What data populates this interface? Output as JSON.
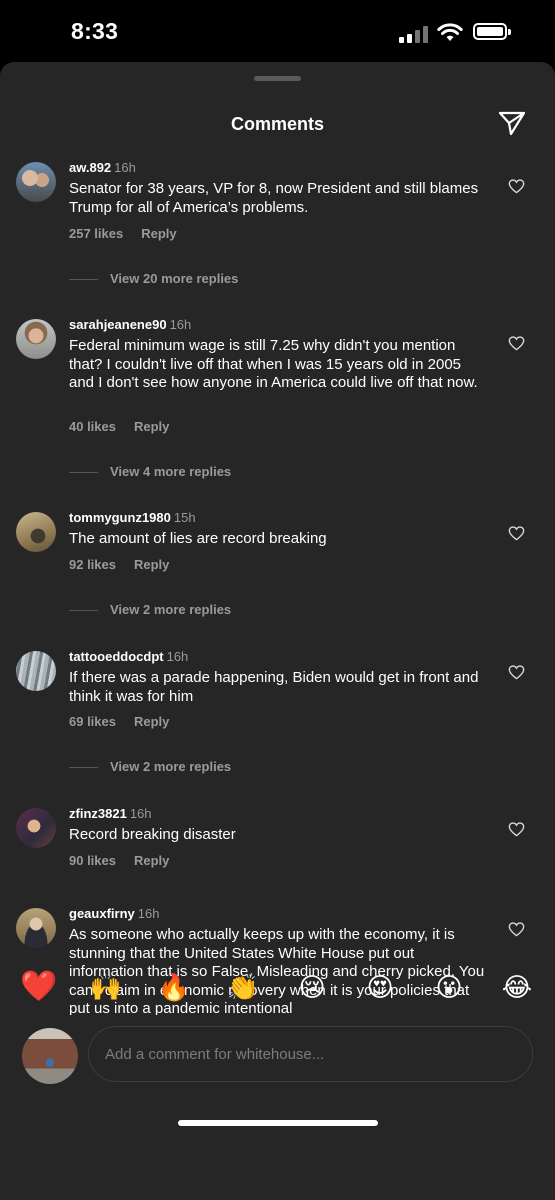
{
  "status": {
    "time": "8:33"
  },
  "header": {
    "title": "Comments"
  },
  "comments": [
    {
      "user": "aw.892",
      "time": "16h",
      "text": "Senator for 38 years, VP for 8, now President and still blames Trump for all of America’s problems.",
      "likes": "257 likes",
      "reply": "Reply",
      "more": "View 20 more replies"
    },
    {
      "user": "sarahjeanene90",
      "time": "16h",
      "text": "Federal minimum wage is still 7.25 why didn't you mention that? I couldn't live off that when I was 15 years old in 2005 and I don't see how anyone in America could live off that now.",
      "likes": "40 likes",
      "reply": "Reply",
      "more": "View 4 more replies"
    },
    {
      "user": "tommygunz1980",
      "time": "15h",
      "text": "The amount of lies are record breaking",
      "likes": "92 likes",
      "reply": "Reply",
      "more": "View 2 more replies"
    },
    {
      "user": "tattooeddocdpt",
      "time": "16h",
      "text": "If there was a parade happening, Biden would get in front and think it was for him",
      "likes": "69 likes",
      "reply": "Reply",
      "more": "View 2 more replies"
    },
    {
      "user": "zfinz3821",
      "time": "16h",
      "text": "Record breaking disaster",
      "likes": "90 likes",
      "reply": "Reply"
    },
    {
      "user": "geauxfirny",
      "time": "16h",
      "text": "As someone who actually keeps up with the economy, it is stunning that the United States White House put out information that is so False, Misleading and cherry picked. You can’t claim in economic recovery when it is your policies that put us into a pandemic intentional"
    }
  ],
  "reactions": [
    "❤️",
    "🙌",
    "🔥",
    "👏",
    "😢",
    "😍",
    "😮",
    "😂"
  ],
  "composer": {
    "placeholder": "Add a comment for whitehouse..."
  },
  "colors": {
    "sheet": "#262626",
    "muted": "#9a9a9a",
    "heart": "#e2222d"
  }
}
